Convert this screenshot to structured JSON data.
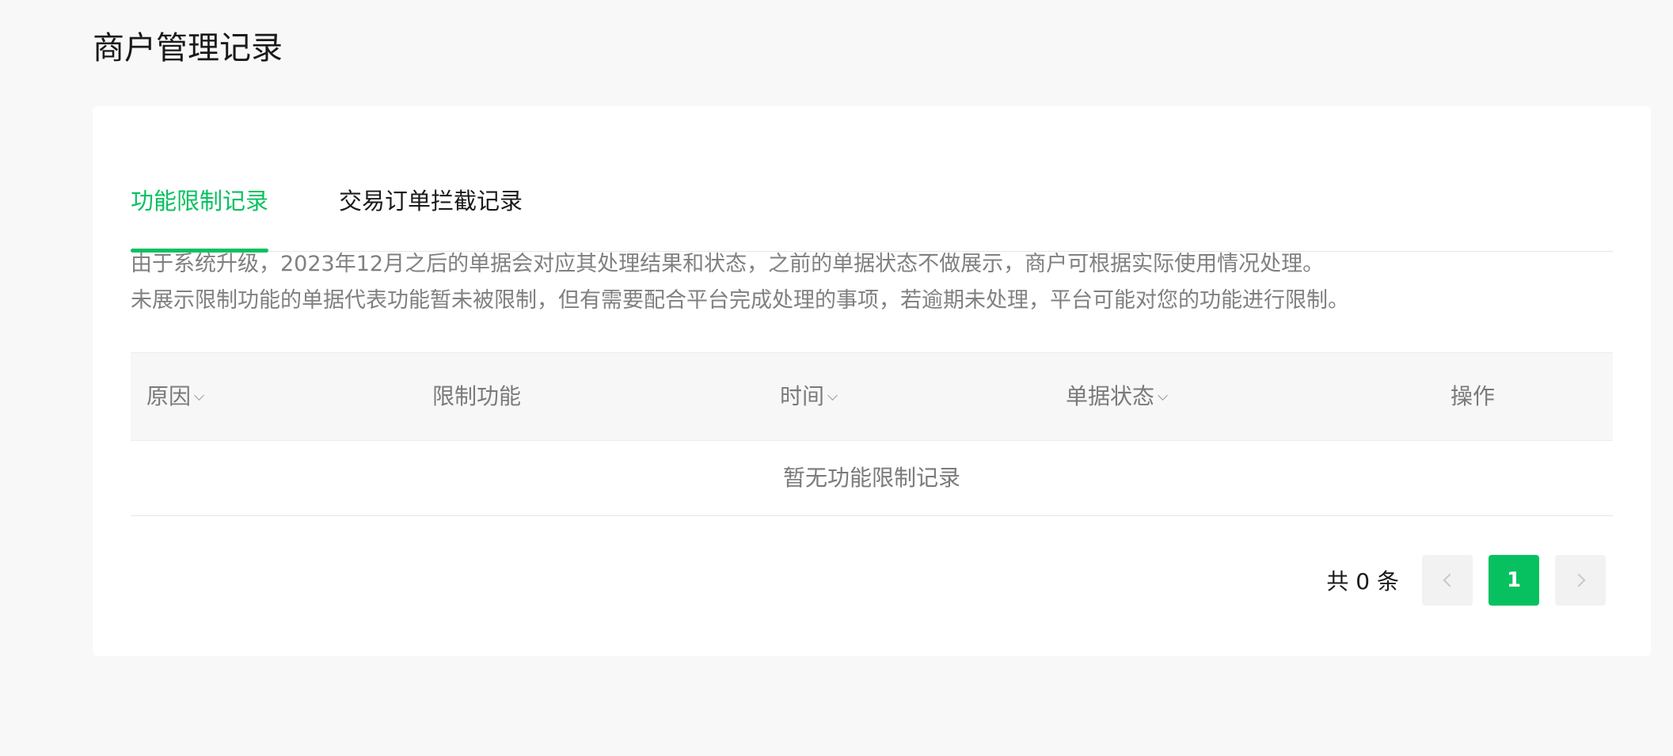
{
  "page": {
    "title": "商户管理记录"
  },
  "tabs": [
    {
      "label": "功能限制记录",
      "active": true
    },
    {
      "label": "交易订单拦截记录",
      "active": false
    }
  ],
  "notice": {
    "line1": "由于系统升级，2023年12月之后的单据会对应其处理结果和状态，之前的单据状态不做展示，商户可根据实际使用情况处理。",
    "line2": "未展示限制功能的单据代表功能暂未被限制，但有需要配合平台完成处理的事项，若逾期未处理，平台可能对您的功能进行限制。"
  },
  "table": {
    "columns": {
      "reason": "原因",
      "function": "限制功能",
      "time": "时间",
      "status": "单据状态",
      "operation": "操作"
    },
    "empty_text": "暂无功能限制记录"
  },
  "pagination": {
    "total_text": "共 0 条",
    "current_page": "1"
  },
  "colors": {
    "accent": "#07c160",
    "background": "#f8f8f8",
    "card": "#ffffff"
  }
}
